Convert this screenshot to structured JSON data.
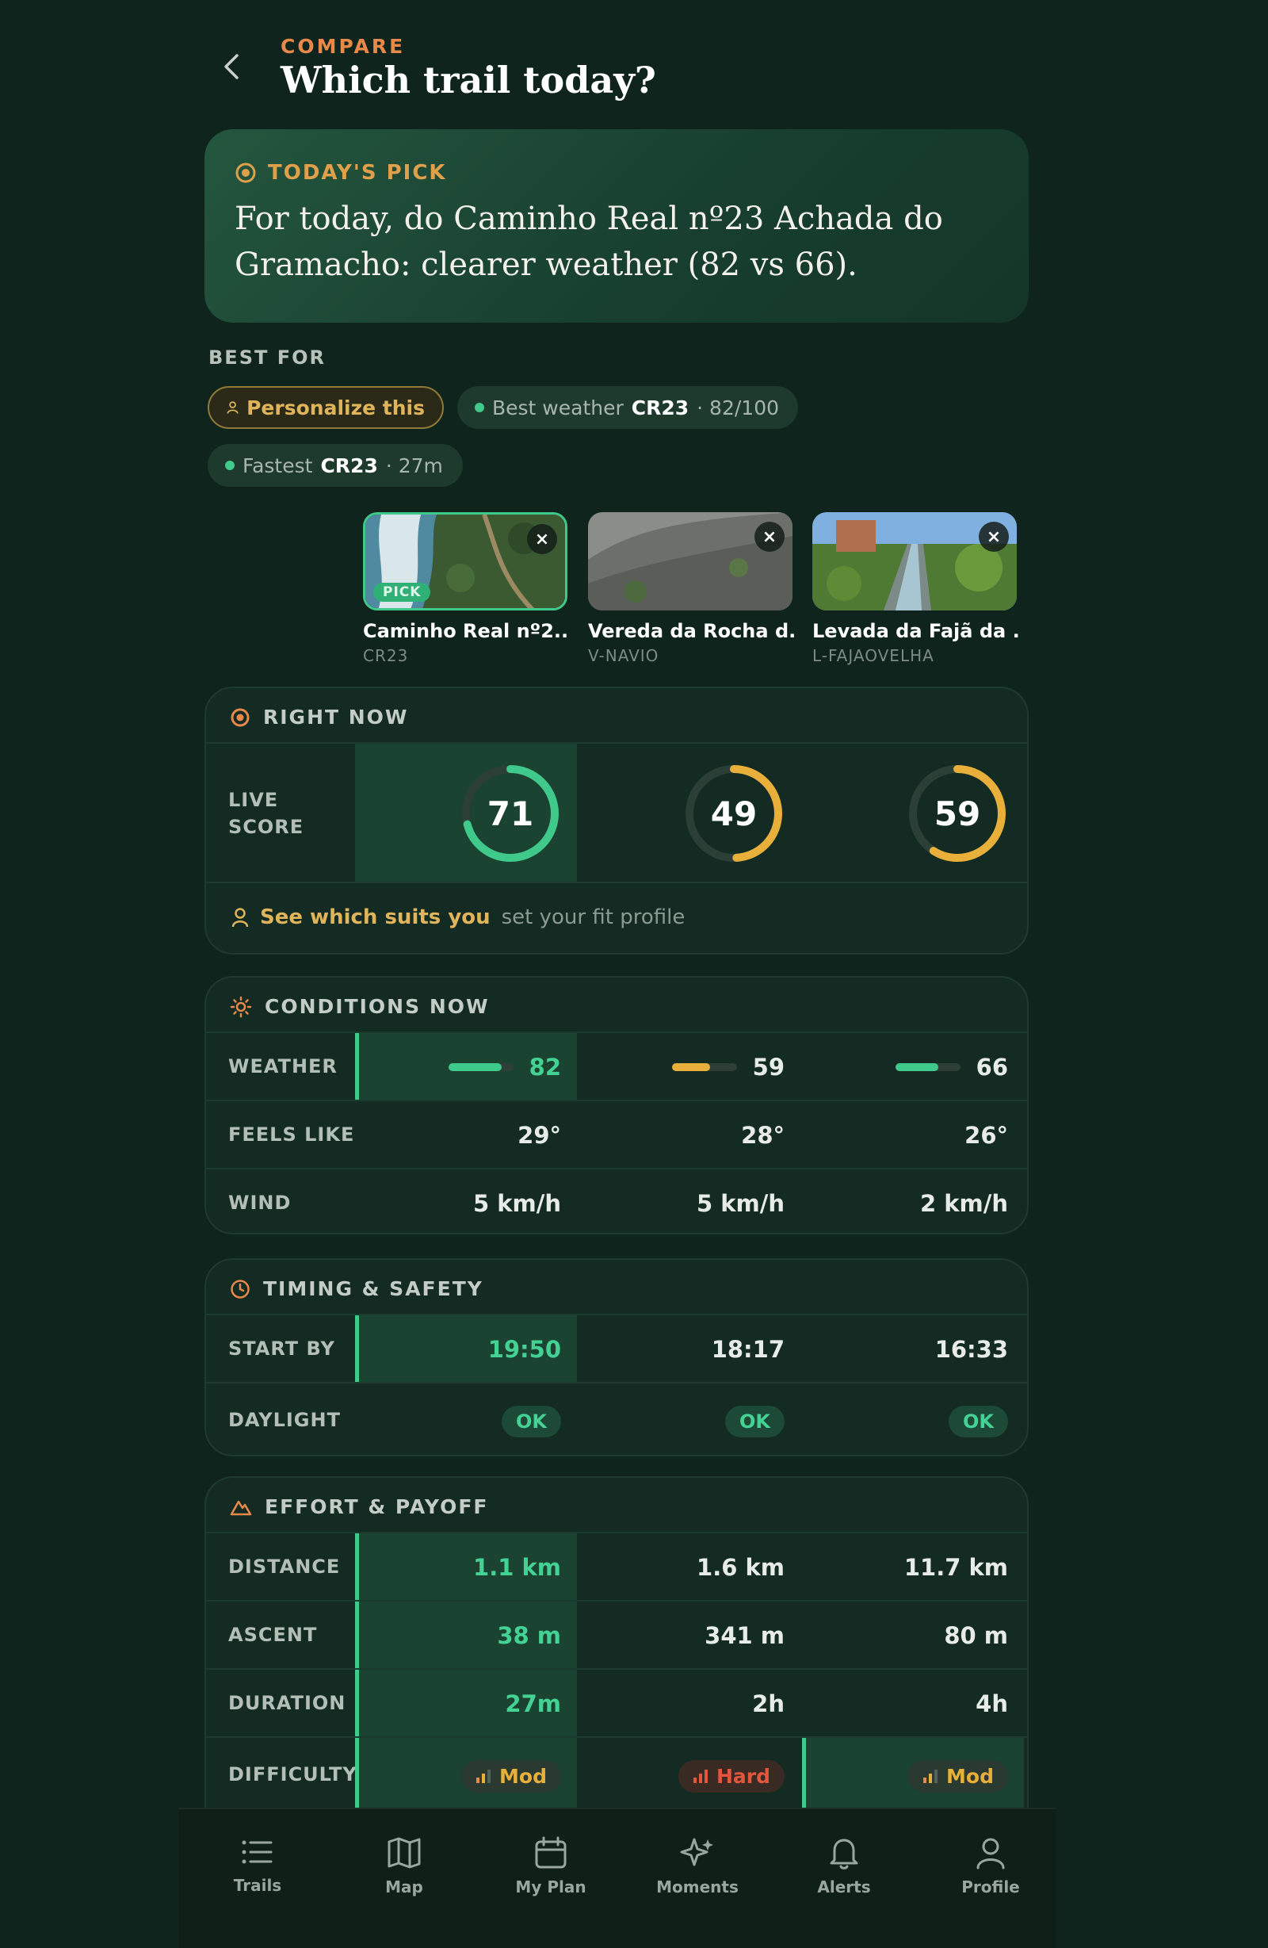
{
  "header": {
    "kicker": "COMPARE",
    "title": "Which trail today?"
  },
  "pick": {
    "label": "TODAY'S PICK",
    "text": "For today, do Caminho Real nº23 Achada do Gramacho: clearer weather (82 vs 66)."
  },
  "best_for": {
    "label": "BEST FOR",
    "personalize": "Personalize this",
    "weather_prefix": "Best weather",
    "weather_code": "CR23",
    "weather_suffix": "· 82/100",
    "fastest_prefix": "Fastest",
    "fastest_code": "CR23",
    "fastest_suffix": "· 27m"
  },
  "trails": [
    {
      "name": "Caminho Real nº2...",
      "code": "CR23",
      "badge": "PICK"
    },
    {
      "name": "Vereda da Rocha d...",
      "code": "V-NAVIO"
    },
    {
      "name": "Levada da Fajã da ...",
      "code": "L-FAJAOVELHA"
    }
  ],
  "close_glyph": "×",
  "right_now": {
    "title": "RIGHT NOW",
    "label_line1": "LIVE",
    "label_line2": "SCORE",
    "scores": [
      71,
      49,
      59
    ],
    "fit_link": "See which suits you",
    "fit_hint": "set your fit profile"
  },
  "conditions": {
    "title": "CONDITIONS NOW",
    "weather_label": "WEATHER",
    "weather": [
      "82",
      "59",
      "66"
    ],
    "feels_label": "FEELS LIKE",
    "feels": [
      "29°",
      "28°",
      "26°"
    ],
    "wind_label": "WIND",
    "wind": [
      "5 km/h",
      "5 km/h",
      "2 km/h"
    ]
  },
  "timing": {
    "title": "TIMING & SAFETY",
    "start_label": "START BY",
    "start": [
      "19:50",
      "18:17",
      "16:33"
    ],
    "daylight_label": "DAYLIGHT",
    "daylight": [
      "OK",
      "OK",
      "OK"
    ]
  },
  "effort": {
    "title": "EFFORT & PAYOFF",
    "distance_label": "DISTANCE",
    "distance": [
      "1.1 km",
      "1.6 km",
      "11.7 km"
    ],
    "ascent_label": "ASCENT",
    "ascent": [
      "38 m",
      "341 m",
      "80 m"
    ],
    "duration_label": "DURATION",
    "duration": [
      "27m",
      "2h",
      "4h"
    ],
    "difficulty_label": "DIFFICULTY",
    "difficulty": [
      "Mod",
      "Hard",
      "Mod"
    ]
  },
  "nav": [
    "Trails",
    "Map",
    "My Plan",
    "Moments",
    "Alerts",
    "Profile"
  ],
  "colors": {
    "accent_green": "#3fc98a",
    "accent_yellow": "#e8b03a",
    "accent_orange": "#e8894a",
    "hard_red": "#e2573b"
  }
}
